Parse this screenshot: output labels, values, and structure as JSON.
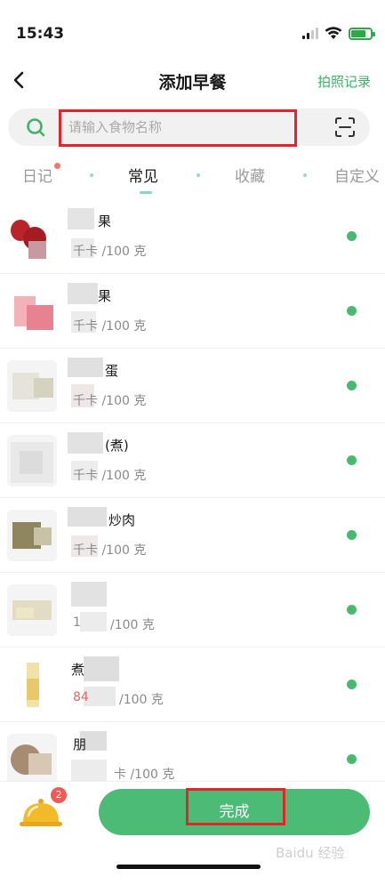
{
  "status_bar": {
    "time": "15:43"
  },
  "header": {
    "title": "添加早餐",
    "right_action": "拍照记录"
  },
  "search": {
    "placeholder": "请输入食物名称",
    "value": ""
  },
  "tabs": [
    {
      "label": "日记",
      "active": false,
      "has_dot": true
    },
    {
      "label": "常见",
      "active": true,
      "has_dot": false
    },
    {
      "label": "收藏",
      "active": false,
      "has_dot": false
    },
    {
      "label": "自定义",
      "active": false,
      "has_dot": false
    }
  ],
  "food_items": [
    {
      "name_visible": "苹果",
      "name_suffix": "果",
      "kcal_text": "千卡 /100 克",
      "prefix": ""
    },
    {
      "name_visible": "",
      "name_suffix": "果",
      "kcal_text": "千卡 /100 克",
      "prefix": ""
    },
    {
      "name_visible": "",
      "name_suffix": "蛋",
      "kcal_text": "千卡 /100 克",
      "prefix": ""
    },
    {
      "name_visible": "",
      "name_suffix": "(煮)",
      "kcal_text": "千卡 /100 克",
      "prefix": ""
    },
    {
      "name_visible": "",
      "name_suffix": "炒肉",
      "kcal_text": "千卡 /100 克",
      "prefix": ""
    },
    {
      "name_visible": "",
      "name_suffix": "",
      "kcal_text": "/100 克",
      "prefix": "1"
    },
    {
      "name_visible": "煮",
      "name_suffix": "",
      "kcal_text": "/100 克",
      "prefix": "84"
    },
    {
      "name_visible": "",
      "name_suffix": "朋",
      "kcal_text": "卡 /100 克",
      "prefix": ""
    }
  ],
  "bottom_bar": {
    "badge_count": "2",
    "done_label": "完成"
  },
  "watermark": "Baidu 经验",
  "colors": {
    "accent": "#4bbb76",
    "highlight_box": "#e3242b",
    "dot": "#49b870"
  }
}
